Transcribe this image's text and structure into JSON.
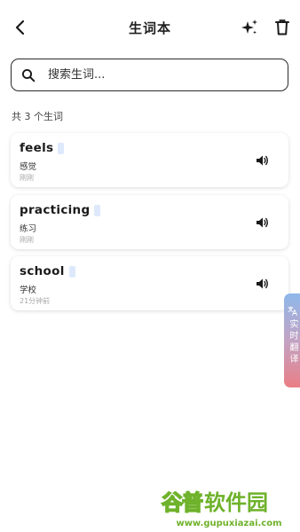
{
  "header": {
    "title": "生词本"
  },
  "search": {
    "placeholder": "搜索生词..."
  },
  "count_label": "共 3 个生词",
  "words": [
    {
      "word": "feels",
      "meaning": "感觉",
      "time": "刚刚"
    },
    {
      "word": "practicing",
      "meaning": "练习",
      "time": "刚刚"
    },
    {
      "word": "school",
      "meaning": "学校",
      "time": "21分钟前"
    }
  ],
  "translate_tab": {
    "label": "实时翻译"
  },
  "watermark": {
    "logo_part1": "谷普",
    "logo_part2": "软件园",
    "url": "www.gupuxiazai.com"
  },
  "colors": {
    "tag_bg": "#dde9fb",
    "tab_top": "#8db8ea",
    "tab_bottom": "#ea7e86",
    "watermark_green": "#6fb22b"
  },
  "icons": {
    "back": "chevron-left-icon",
    "sparkle": "sparkle-icon",
    "trash": "trash-icon",
    "search": "search-icon",
    "speaker": "speaker-icon",
    "translate": "translate-icon"
  }
}
